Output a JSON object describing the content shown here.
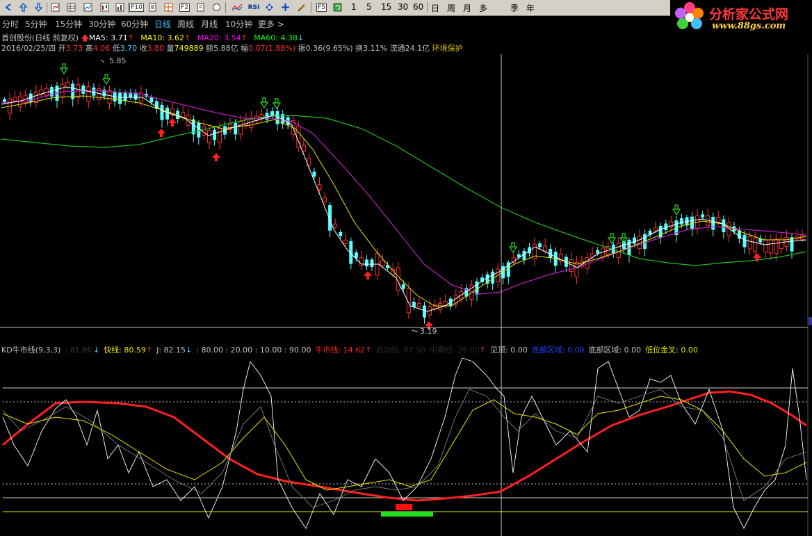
{
  "toolbar": {
    "icons": [
      "left-arrow-icon",
      "up-arrow-icon",
      "down-arrow-icon",
      "kline-icon",
      "line-chart-icon",
      "candle-icon",
      "bar-icon",
      "fundamental-f10-icon",
      "table-icon",
      "f2-icon",
      "report-icon",
      "circle-icon",
      "compare-icon",
      "rsi-icon",
      "move-icon",
      "pencil-icon",
      "f5-icon",
      "refresh-icon"
    ],
    "rsi_label": "RSI",
    "f10_label": "F10",
    "f2_label": "F2",
    "f5_label": "F5",
    "minute_buttons": [
      "1",
      "5",
      "15",
      "30",
      "60"
    ],
    "period_buttons": [
      "日",
      "周",
      "月",
      "多",
      "季",
      "年"
    ]
  },
  "logo": {
    "title": "分析家公式网",
    "url": "www.88gs.com"
  },
  "periods": {
    "items": [
      "分时",
      "5分钟",
      "15分钟",
      "30分钟",
      "60分钟",
      "日线",
      "周线",
      "月线",
      "10分钟",
      "更多"
    ],
    "active": "日线",
    "more_arrow": ">"
  },
  "stock": {
    "name": "首创股份(日线 前复权)",
    "ma5_label": "MA5: 3.71",
    "ma10_label": "MA10: 3.62",
    "ma20_label": "MA20: 3.54",
    "ma60_label": "MA60: 4.38",
    "date": "2016/02/25/四",
    "open_label": "开",
    "open": "3.73",
    "high_label": "高",
    "high": "4.06",
    "low_label": "低",
    "low": "3.70",
    "close_label": "收",
    "close": "3.80",
    "vol_label": "量",
    "vol": "749889",
    "amount_label": "额",
    "amount": "5.88亿",
    "change_label": "幅",
    "change": "0.07(1.88%)",
    "amplitude_label": "振",
    "amplitude": "0.36(9.65%)",
    "turnover_label": "换",
    "turnover": "3.11%",
    "float_label": "流通",
    "float": "24.1亿",
    "sector": "环境保护",
    "high_mark": "5.85",
    "low_mark": "3.19"
  },
  "indicator": {
    "name": "KD牛市线(9,3,3)",
    "slow_line": ": 81.86",
    "fast_line": "快线: 80.59",
    "j_line": "J: 82.15",
    "levels": ": 80.00 : 20.00 : 10.00 : 90.00",
    "bull_line": "牛市线: 14.62",
    "hidden_1": "启动线: 87.90",
    "hidden_2": "中期线: 26.00",
    "top_signal": "见顶: 0.00",
    "bottom_zone_blue": "底部区域: 0.00",
    "bottom_zone": "底部区域: 0.00",
    "low_golden_cross": "低位金叉: 0.00"
  },
  "chart_data": {
    "type": "candlestick",
    "title": "首创股份(日线 前复权)",
    "price_marks": {
      "high": 5.85,
      "low": 3.19
    },
    "ma_latest": {
      "MA5": 3.71,
      "MA10": 3.62,
      "MA20": 3.54,
      "MA60": 4.38
    },
    "kd_latest": {
      "slow": 81.86,
      "fast": 80.59,
      "J": 82.15,
      "bull_line": 14.62
    },
    "kd_levels": [
      80,
      20,
      10,
      90
    ],
    "kd_ylim": [
      0,
      100
    ],
    "colors": {
      "up": "#ff3232",
      "down": "#54ffff",
      "ma5": "#ffffff",
      "ma10": "#ffff00",
      "ma20": "#ff00ff",
      "ma60": "#00ff00",
      "bull": "#ff0000"
    }
  },
  "colors": {
    "up_red": "#ff3232",
    "down_cyan": "#54ffff",
    "ma5": "#ffffff",
    "ma10": "#e8e800",
    "ma20": "#c020c0",
    "ma60": "#20c020",
    "bull_line": "#ff2020",
    "text_gray": "#c0c0c0"
  }
}
